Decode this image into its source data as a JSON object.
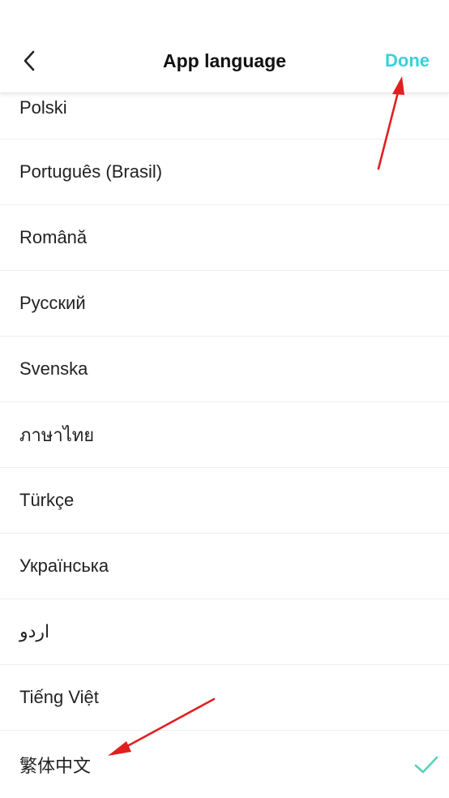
{
  "header": {
    "title": "App language",
    "done_label": "Done"
  },
  "languages": [
    "Polski",
    "Português (Brasil)",
    "Română",
    "Русский",
    "Svenska",
    "ภาษาไทย",
    "Türkçe",
    "Українська",
    "اردو",
    "Tiếng Việt",
    "繁体中文"
  ],
  "selected_language": "繁体中文",
  "colors": {
    "accent": "#35d3d8",
    "check": "#5ad2b5",
    "annotation_arrow": "#e02020"
  },
  "icons": {
    "back": "chevron-left-icon",
    "selected": "check-icon"
  }
}
